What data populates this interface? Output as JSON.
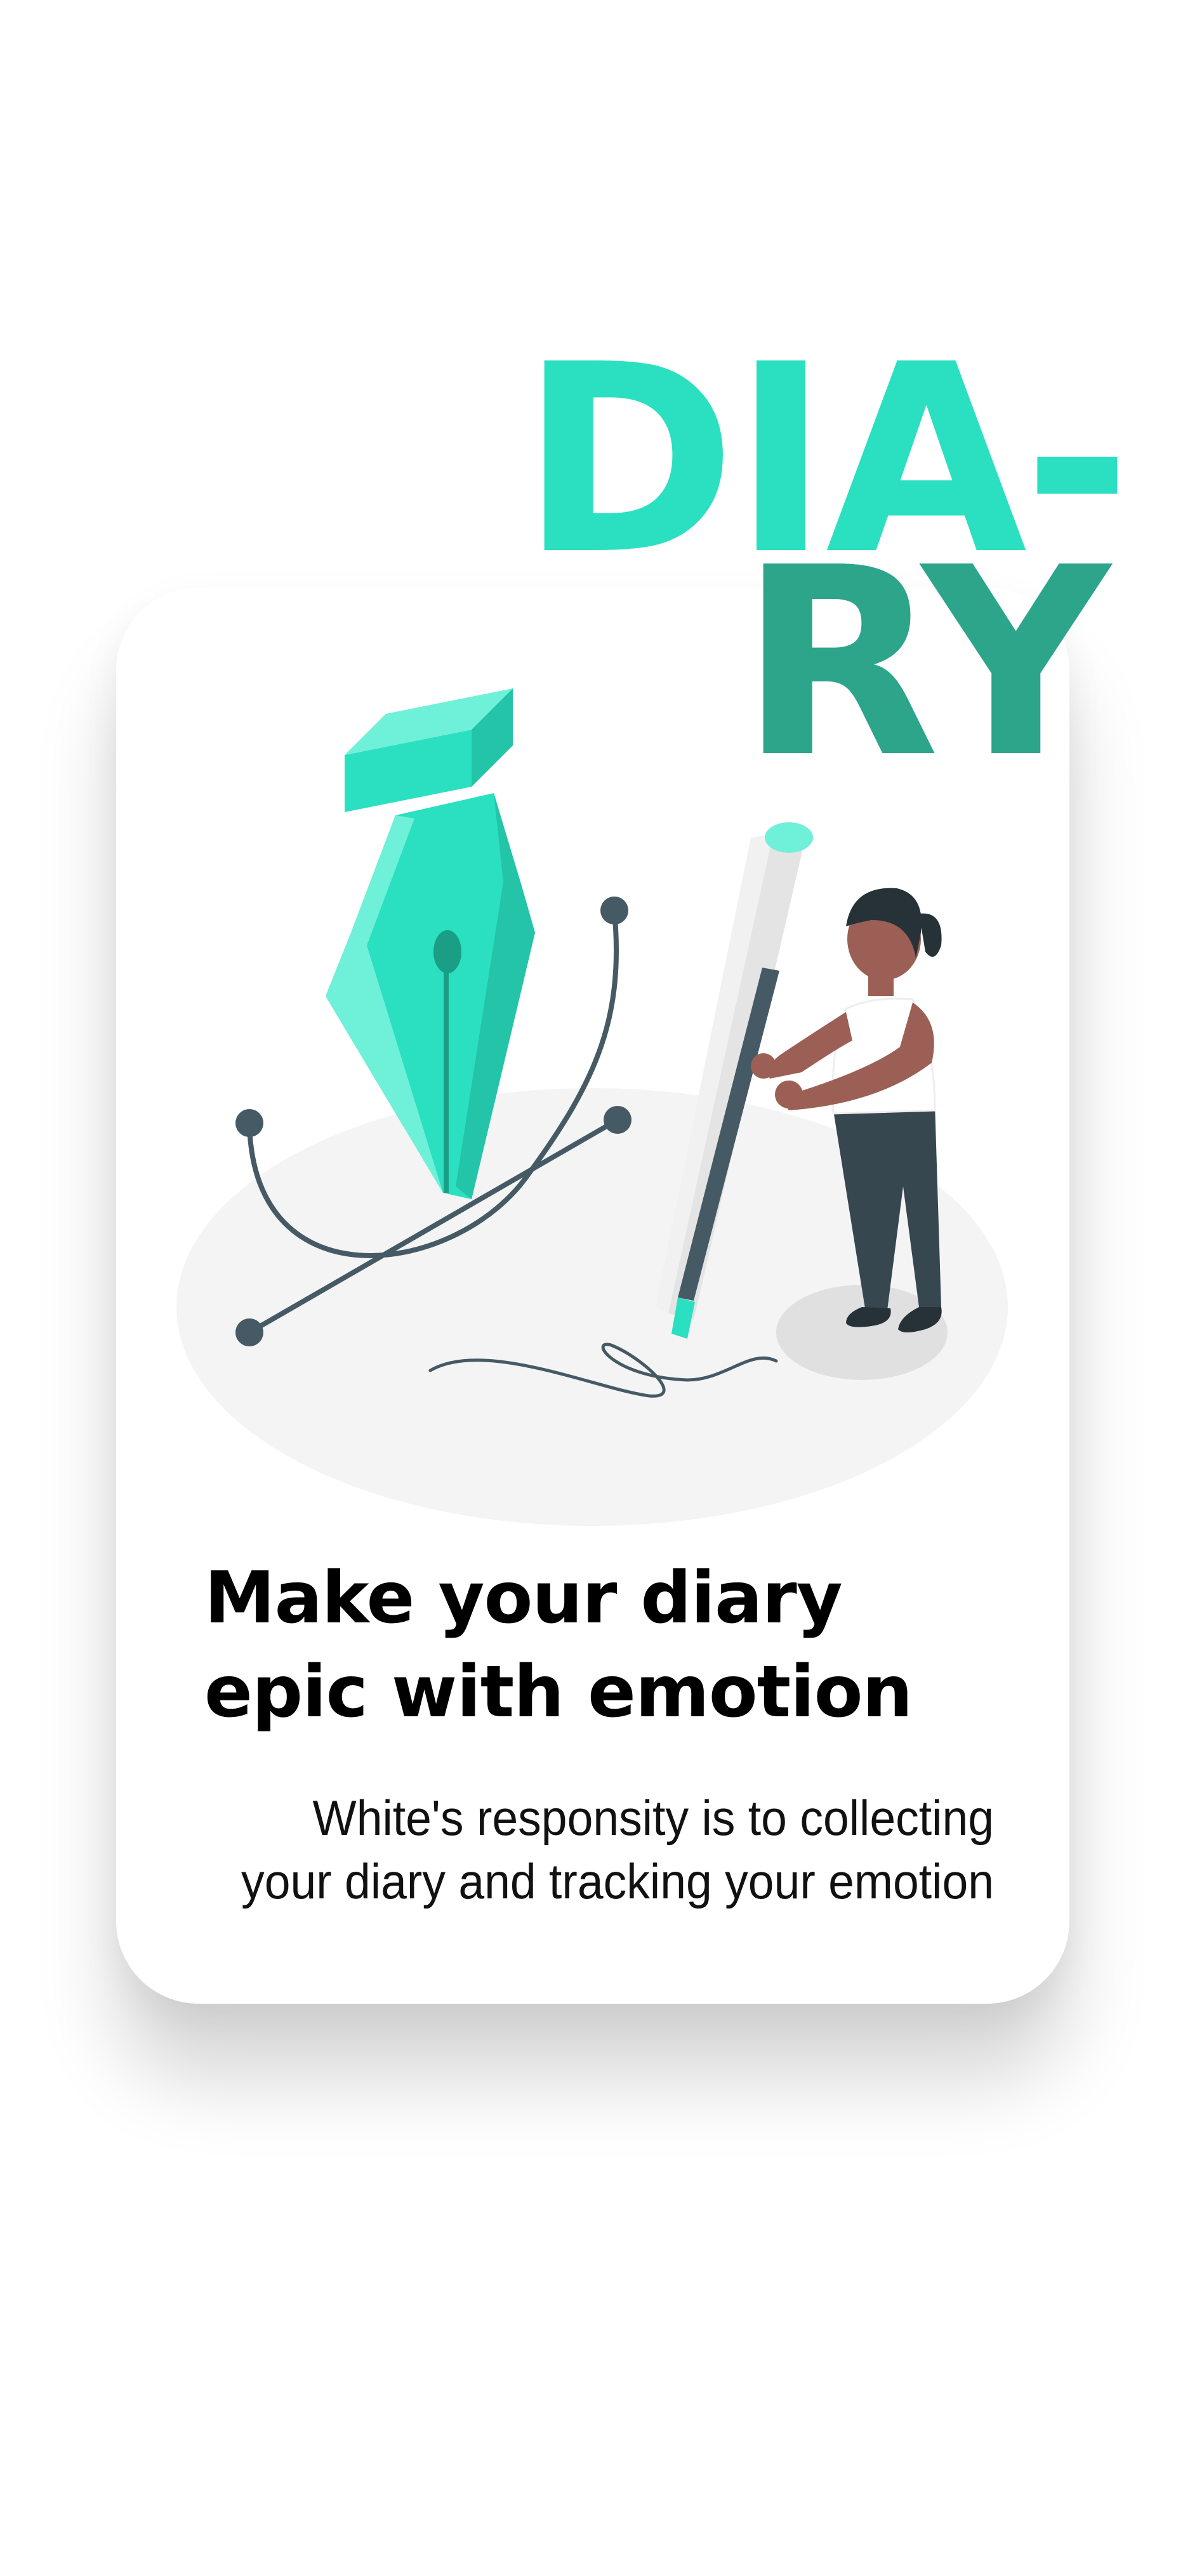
{
  "brand": {
    "logo_line_1": "DIA-",
    "logo_line_2": "RY",
    "primary_color": "#2ae0c0",
    "secondary_color": "#2ca58b"
  },
  "onboarding": {
    "illustration": "pen-nib-and-woman-with-giant-pencil",
    "headline_line_1": "Make your diary",
    "headline_line_2": "epic with emotion",
    "description_line_1": "White's responsity is to collecting",
    "description_line_2": "your diary and tracking your emotion"
  }
}
